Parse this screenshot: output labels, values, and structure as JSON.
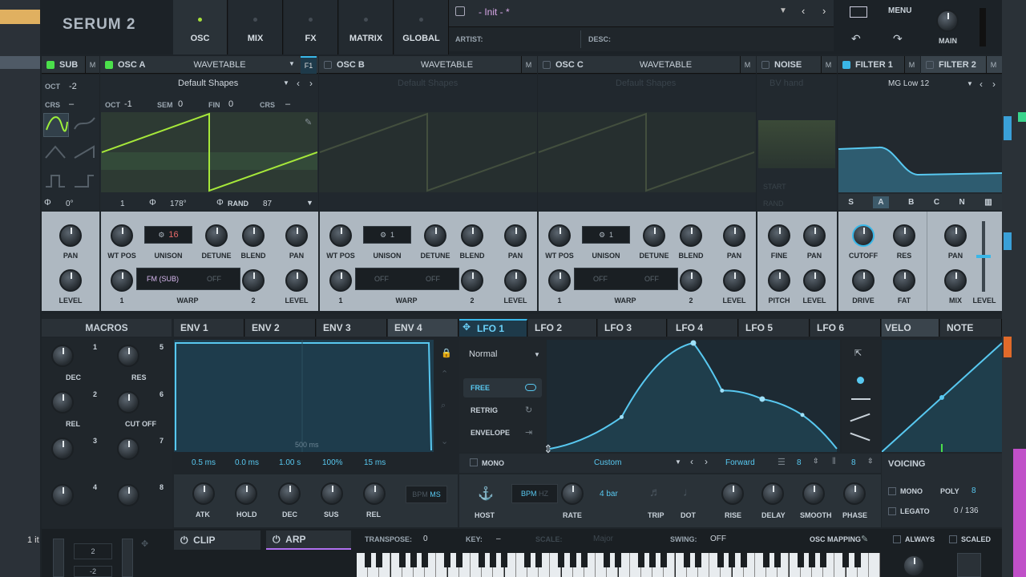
{
  "app": {
    "logo": "SERUM 2",
    "nav": [
      "OSC",
      "MIX",
      "FX",
      "MATRIX",
      "GLOBAL"
    ],
    "preset": "- Init - *",
    "artist": "ARTIST:",
    "desc": "DESC:",
    "menu": "MENU",
    "main": "MAIN"
  },
  "osc": {
    "sub": {
      "name": "SUB",
      "oct_label": "OCT",
      "oct": "-2",
      "crs_label": "CRS",
      "crs": "–",
      "phase": "0°",
      "m": "M"
    },
    "a": {
      "name": "OSC A",
      "type": "WAVETABLE",
      "f1": "F1",
      "table": "Default Shapes",
      "oct_label": "OCT",
      "oct": "-1",
      "sem_label": "SEM",
      "sem": "0",
      "fin_label": "FIN",
      "fin": "0",
      "crs_label": "CRS",
      "crs": "–",
      "wtpos": "1",
      "phase": "178°",
      "rand": "RAND",
      "randval": "87",
      "m": "M",
      "unison": "16",
      "warp1": "FM (SUB)",
      "warp2": "OFF"
    },
    "b": {
      "name": "OSC B",
      "type": "WAVETABLE",
      "table": "Default Shapes",
      "m": "M",
      "unison": "1",
      "warp1": "OFF",
      "warp2": "OFF"
    },
    "c": {
      "name": "OSC C",
      "type": "WAVETABLE",
      "table": "Default Shapes",
      "m": "M",
      "unison": "1",
      "warp1": "OFF",
      "warp2": "OFF"
    },
    "noise": {
      "name": "NOISE",
      "table": "BV hand",
      "start": "START",
      "rand": "RAND",
      "m": "M"
    },
    "filter1": {
      "name": "FILTER 1",
      "type": "MG Low 12",
      "m": "M",
      "routes": [
        "S",
        "A",
        "B",
        "C",
        "N",
        "▥"
      ]
    },
    "filter2": {
      "name": "FILTER 2",
      "m": "M"
    }
  },
  "knobs": {
    "pan": "PAN",
    "level": "LEVEL",
    "wtpos": "WT POS",
    "unison": "UNISON",
    "detune": "DETUNE",
    "blend": "BLEND",
    "warp": "WARP",
    "fine": "FINE",
    "pitch": "PITCH",
    "cutoff": "CUTOFF",
    "res": "RES",
    "drive": "DRIVE",
    "fat": "FAT",
    "mix": "MIX",
    "one": "1",
    "two": "2"
  },
  "mod": {
    "macros_title": "MACROS",
    "macros": [
      {
        "n": "1",
        "label": "DEC"
      },
      {
        "n": "5",
        "label": "RES"
      },
      {
        "n": "2",
        "label": "REL"
      },
      {
        "n": "6",
        "label": "CUT OFF"
      },
      {
        "n": "3",
        "label": ""
      },
      {
        "n": "7",
        "label": ""
      },
      {
        "n": "4",
        "label": ""
      },
      {
        "n": "8",
        "label": ""
      }
    ],
    "tabs": [
      "ENV 1",
      "ENV 2",
      "ENV 3",
      "ENV 4",
      "LFO 1",
      "LFO 2",
      "LFO 3",
      "LFO 4",
      "LFO 5",
      "LFO 6",
      "VELO",
      "NOTE"
    ],
    "env": {
      "time": "500 ms",
      "values": [
        "0.5 ms",
        "0.0 ms",
        "1.00 s",
        "100%",
        "15 ms"
      ],
      "labels": [
        "ATK",
        "HOLD",
        "DEC",
        "SUS",
        "REL"
      ],
      "bpm": "BPM",
      "ms": "MS"
    },
    "lfo": {
      "mode": "Normal",
      "modes": [
        "FREE",
        "RETRIG",
        "ENVELOPE"
      ],
      "mono": "MONO",
      "shape": "Custom",
      "dir": "Forward",
      "grid1": "8",
      "grid2": "8",
      "bpm": "BPM",
      "hz": "HZ",
      "rate": "4 bar",
      "labels": [
        "HOST",
        "RATE",
        "TRIP",
        "DOT",
        "RISE",
        "DELAY",
        "SMOOTH",
        "PHASE"
      ],
      "points": [
        [
          0,
          0
        ],
        [
          0.25,
          0.3
        ],
        [
          0.5,
          1
        ],
        [
          0.6,
          0.55
        ],
        [
          0.74,
          0.47
        ],
        [
          0.88,
          0.32
        ],
        [
          1,
          0
        ]
      ]
    },
    "voicing": {
      "title": "VOICING",
      "mono": "MONO",
      "poly": "POLY",
      "poly_val": "8",
      "legato": "LEGATO",
      "voices": "0 / 136"
    }
  },
  "bottom": {
    "clip": "CLIP",
    "arp": "ARP",
    "transpose": "TRANSPOSE:",
    "transpose_val": "0",
    "key": "KEY:",
    "key_val": "–",
    "scale": "SCALE:",
    "scale_val": "Major",
    "swing": "SWING:",
    "swing_val": "OFF",
    "osc_mapping": "OSC MAPPING",
    "always": "ALWAYS",
    "scaled": "SCALED",
    "bend_up": "2",
    "bend_down": "-2",
    "daw_label": "1 it"
  }
}
